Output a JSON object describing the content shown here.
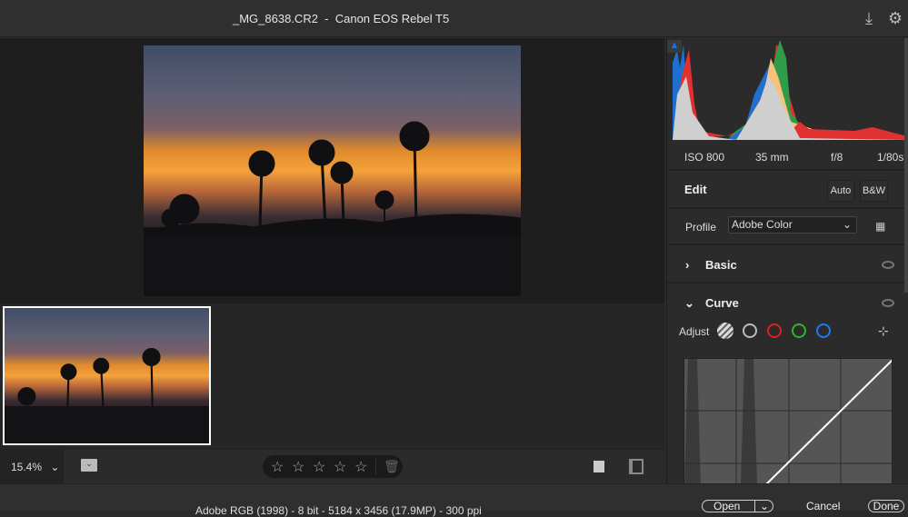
{
  "header": {
    "title": "_MG_8638.CR2  -  Canon EOS Rebel T5",
    "icons": [
      "save-icon",
      "gear-icon"
    ]
  },
  "toolbar": {
    "zoom": "15.4%",
    "rating": 0,
    "max_rating": 5
  },
  "exif": {
    "iso": "ISO 800",
    "focal": "35 mm",
    "aperture": "f/8",
    "shutter": "1/80s"
  },
  "edit": {
    "title": "Edit",
    "auto": "Auto",
    "bw": "B&W",
    "profile_label": "Profile",
    "profile_value": "Adobe Color"
  },
  "sections": {
    "basic": "Basic",
    "curve": "Curve",
    "adjust": "Adjust"
  },
  "status": {
    "info": "Adobe RGB (1998) - 8 bit - 5184 x 3456 (17.9MP) - 300 ppi",
    "open": "Open",
    "cancel": "Cancel",
    "done": "Done"
  },
  "colors": {
    "accent": "#1473e6",
    "red": "#e02020",
    "green": "#2db52d",
    "blue": "#1e78f0"
  }
}
